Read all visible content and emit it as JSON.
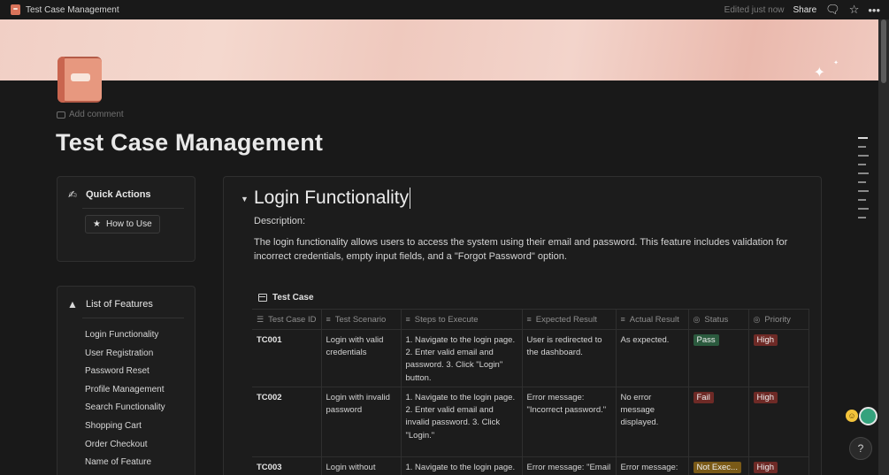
{
  "topbar": {
    "title": "Test Case Management",
    "edited": "Edited just now",
    "share": "Share",
    "icons": [
      "comment-icon",
      "star-icon",
      "more-icon"
    ]
  },
  "page": {
    "add_comment": "Add comment",
    "title": "Test Case Management"
  },
  "quick_actions": {
    "title": "Quick Actions",
    "how_to_use": "How to Use"
  },
  "features": {
    "title": "List of Features",
    "items": [
      "Login Functionality",
      "User Registration",
      "Password Reset",
      "Profile Management",
      "Search Functionality",
      "Shopping Cart",
      "Order Checkout",
      "Name of Feature"
    ]
  },
  "section": {
    "title": "Login Functionality",
    "description_label": "Description:",
    "description": "The login functionality allows users to access the system using their email and password. This feature includes validation for incorrect credentials, empty input fields, and a \"Forgot Password\" option."
  },
  "table": {
    "title": "Test Case",
    "columns": [
      "Test Case ID",
      "Test Scenario",
      "Steps to Execute",
      "Expected Result",
      "Actual Result",
      "Status",
      "Priority"
    ],
    "rows": [
      {
        "id": "TC001",
        "scenario": "Login with valid credentials",
        "steps": "1. Navigate to the login page. 2. Enter valid email and password. 3. Click \"Login\" button.",
        "expected": "User is redirected to the dashboard.",
        "actual": "As expected.",
        "status": "Pass",
        "priority": "High"
      },
      {
        "id": "TC002",
        "scenario": "Login with invalid password",
        "steps": "1. Navigate to the login page. 2. Enter valid email and invalid password. 3. Click \"Login.\"",
        "expected": "Error message: \"Incorrect password.\"",
        "actual": "No error message displayed.",
        "status": "Fail",
        "priority": "High"
      },
      {
        "id": "TC003",
        "scenario": "Login without",
        "steps": "1. Navigate to the login page.",
        "expected": "Error message: \"Email",
        "actual": "Error message:",
        "status": "Not Exec...",
        "priority": "High"
      }
    ]
  },
  "colors": {
    "background": "#191919",
    "pass": "#2b5a3e",
    "fail": "#6e2a26",
    "not_executed": "#7a5a17"
  }
}
